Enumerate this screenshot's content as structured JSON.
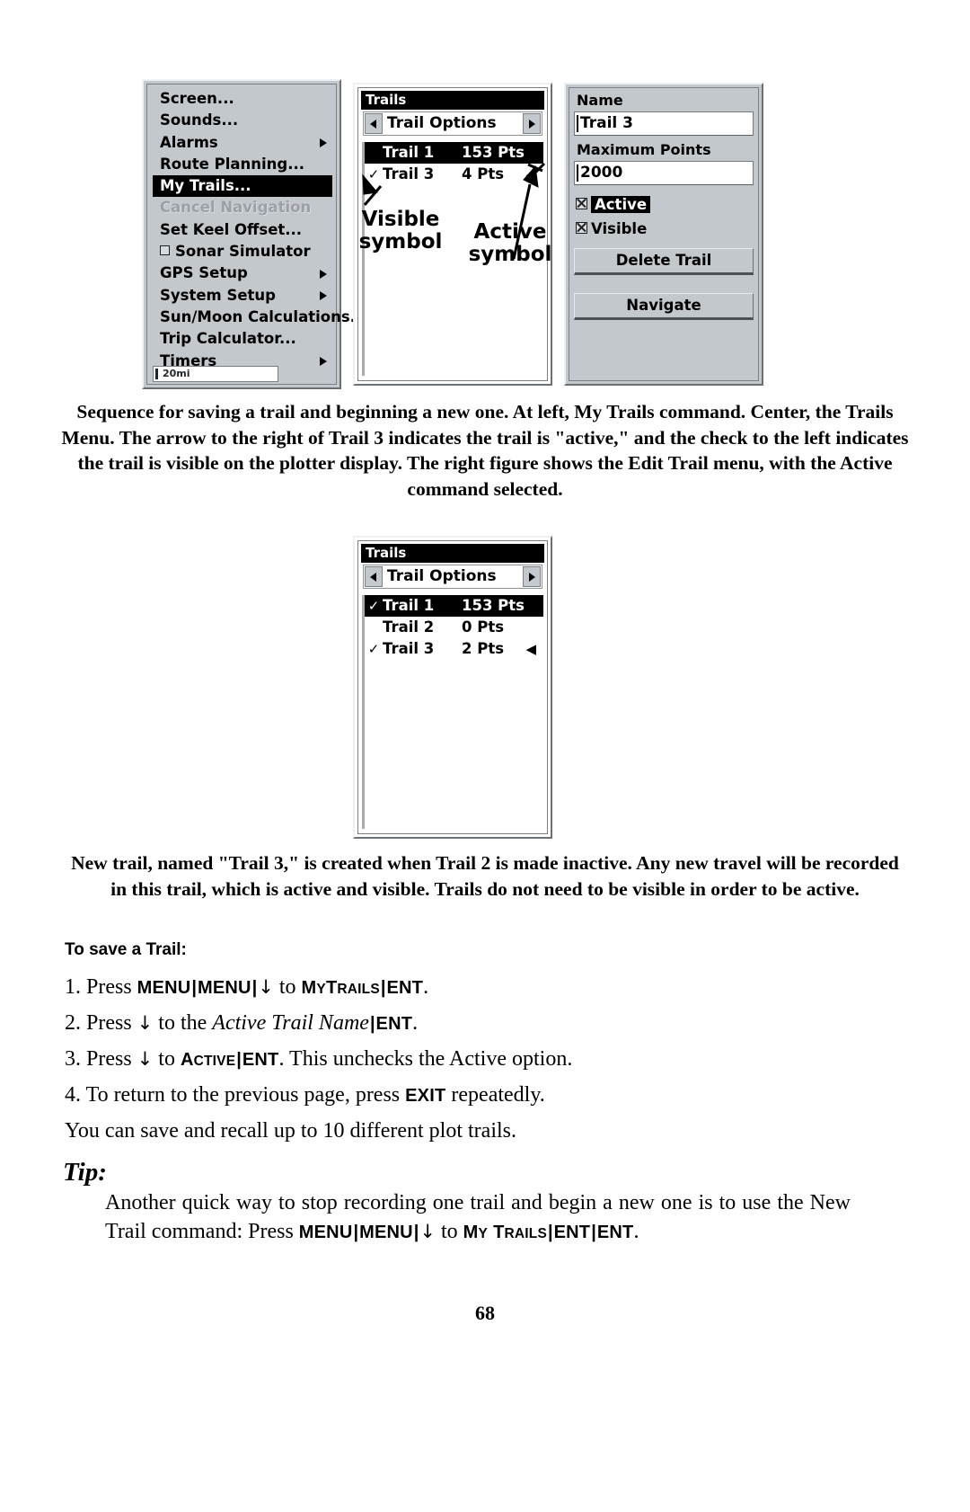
{
  "menu_panel": {
    "scale_label": "20mi",
    "items": [
      {
        "label": "Screen...",
        "state": "normal",
        "submenu": false,
        "checkbox": false
      },
      {
        "label": "Sounds...",
        "state": "normal",
        "submenu": false,
        "checkbox": false
      },
      {
        "label": "Alarms",
        "state": "normal",
        "submenu": true,
        "checkbox": false
      },
      {
        "label": "Route Planning...",
        "state": "normal",
        "submenu": false,
        "checkbox": false
      },
      {
        "label": "My Trails...",
        "state": "selected",
        "submenu": false,
        "checkbox": false
      },
      {
        "label": "Cancel Navigation",
        "state": "disabled",
        "submenu": false,
        "checkbox": false
      },
      {
        "label": "Set Keel Offset...",
        "state": "normal",
        "submenu": false,
        "checkbox": false
      },
      {
        "label": "Sonar Simulator",
        "state": "normal",
        "submenu": false,
        "checkbox": true
      },
      {
        "label": "GPS Setup",
        "state": "normal",
        "submenu": true,
        "checkbox": false
      },
      {
        "label": "System Setup",
        "state": "normal",
        "submenu": true,
        "checkbox": false
      },
      {
        "label": "Sun/Moon Calculations...",
        "state": "normal",
        "submenu": false,
        "checkbox": false
      },
      {
        "label": "Trip Calculator...",
        "state": "normal",
        "submenu": false,
        "checkbox": false
      },
      {
        "label": "Timers",
        "state": "normal",
        "submenu": true,
        "checkbox": false
      }
    ]
  },
  "trails_panel_1": {
    "title": "Trails",
    "options_label": "Trail Options",
    "rows": [
      {
        "check": "",
        "name": "Trail 1",
        "pts": "153 Pts",
        "selected": true,
        "active": ""
      },
      {
        "check": "✓",
        "name": "Trail 3",
        "pts": "4 Pts",
        "selected": false,
        "active": "◀"
      }
    ]
  },
  "trails_panel_2": {
    "title": "Trails",
    "options_label": "Trail Options",
    "rows": [
      {
        "check": "✓",
        "name": "Trail 1",
        "pts": "153 Pts",
        "selected": true,
        "active": ""
      },
      {
        "check": "",
        "name": "Trail 2",
        "pts": "0 Pts",
        "selected": false,
        "active": ""
      },
      {
        "check": "✓",
        "name": "Trail 3",
        "pts": "2 Pts",
        "selected": false,
        "active": "◀"
      }
    ]
  },
  "edit_panel": {
    "name_label": "Name",
    "name_value": "Trail 3",
    "max_points_label": "Maximum Points",
    "max_points_value": "2000",
    "active_label": "Active",
    "visible_label": "Visible",
    "delete_button": "Delete Trail",
    "navigate_button": "Navigate"
  },
  "annotations": {
    "visible_symbol": "Visible\nsymbol",
    "active_symbol": "Active\nsymbol"
  },
  "captions": {
    "figure_1": "Sequence for saving a trail and beginning a new one. At left, My Trails command. Center, the Trails Menu. The arrow to the right of Trail 3 indicates the trail is \"active,\" and the check to the left indicates the trail is visible on the plotter display. The right figure shows the Edit Trail menu, with the Active command selected.",
    "figure_2": "New trail, named \"Trail 3,\" is created when Trail 2 is made inactive. Any new travel will be recorded in this trail, which is active and visible. Trails do not need to be visible in order to be active."
  },
  "procedure": {
    "heading": "To save a Trail:",
    "step1": {
      "num": "1.",
      "press": "Press",
      "k1": "MENU",
      "k2": "MENU",
      "arrow": "↓",
      "to": "to",
      "k3_my": "M",
      "k3_y": "Y",
      "k3_t": "T",
      "k3_rails": "RAILS",
      "k4": "ENT",
      "period": "."
    },
    "step2": {
      "num": "2.",
      "press": "Press",
      "arrow": "↓",
      "to": "to the",
      "italic": "Active Trail Name",
      "k1": "ENT",
      "period": "."
    },
    "step3": {
      "num": "3.",
      "press": "Press",
      "arrow": "↓",
      "to": "to",
      "kA": "A",
      "kCTIVE": "CTIVE",
      "k1": "ENT",
      "tail": ". This unchecks the Active option."
    },
    "step4": {
      "num": "4.",
      "text_a": "To return to the previous page, press",
      "k1": "EXIT",
      "text_b": "repeatedly."
    },
    "note": "You can save and recall up to 10 different plot trails."
  },
  "tip": {
    "heading": "Tip:",
    "body_a": "Another quick way to stop recording one trail and begin a new one is to use the New Trail command: Press",
    "k1": "MENU",
    "k2": "MENU",
    "arrow": "↓",
    "to": "to",
    "k3_m": "M",
    "k3_y": "Y",
    "k4_t": "T",
    "k4_rails": "RAILS",
    "k5": "ENT",
    "k6": "ENT",
    "period": "."
  },
  "footer": {
    "page_number": "68"
  }
}
